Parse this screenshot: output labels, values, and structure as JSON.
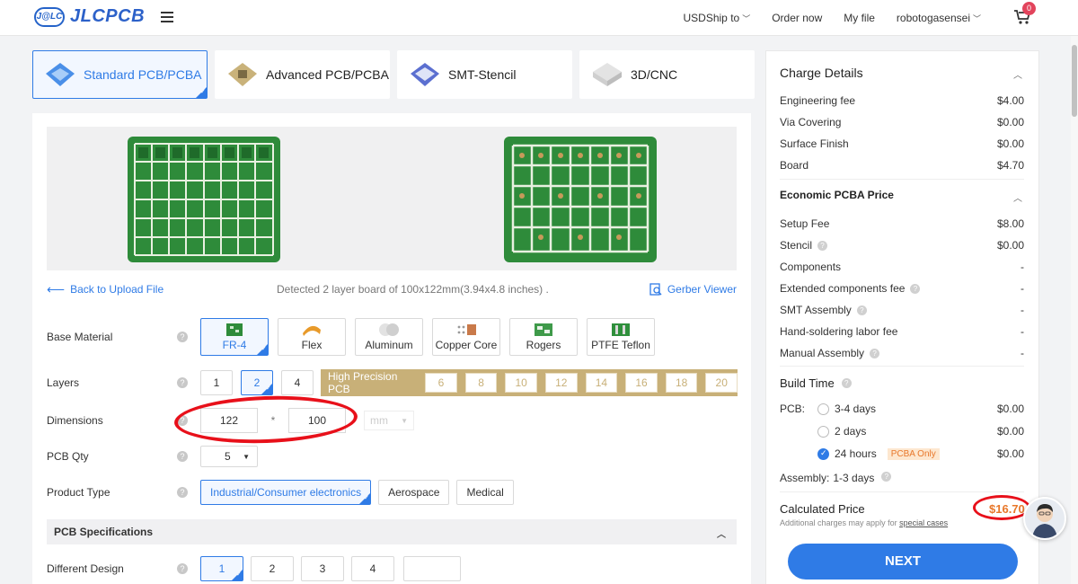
{
  "header": {
    "logo_badge": "J@LC",
    "logo_text": "JLCPCB",
    "nav": [
      {
        "label": "USDShip to",
        "caret": true
      },
      {
        "label": "Order now",
        "caret": false
      },
      {
        "label": "My file",
        "caret": false
      },
      {
        "label": "robotogasensei",
        "caret": true
      }
    ],
    "cart_count": "0"
  },
  "product_tabs": [
    {
      "label": "Standard PCB/PCBA",
      "active": true
    },
    {
      "label": "Advanced PCB/PCBA",
      "active": false
    },
    {
      "label": "SMT-Stencil",
      "active": false
    },
    {
      "label": "3D/CNC",
      "active": false
    }
  ],
  "file_row": {
    "back_label": "Back to Upload File",
    "detected": "Detected 2 layer board of 100x122mm(3.94x4.8 inches) .",
    "gerber_label": "Gerber Viewer"
  },
  "form": {
    "base_material": {
      "label": "Base Material",
      "options": [
        "FR-4",
        "Flex",
        "Aluminum",
        "Copper Core",
        "Rogers",
        "PTFE Teflon"
      ],
      "selected": "FR-4"
    },
    "layers": {
      "label": "Layers",
      "options": [
        "1",
        "2",
        "4"
      ],
      "selected": "2",
      "high_precision_label": "High Precision PCB",
      "high_precision_options": [
        "6",
        "8",
        "10",
        "12",
        "14",
        "16",
        "18",
        "20"
      ]
    },
    "dimensions": {
      "label": "Dimensions",
      "width": "122",
      "separator": "*",
      "height": "100",
      "unit": "mm"
    },
    "pcb_qty": {
      "label": "PCB Qty",
      "value": "5"
    },
    "product_type": {
      "label": "Product Type",
      "options": [
        "Industrial/Consumer electronics",
        "Aerospace",
        "Medical"
      ],
      "selected": "Industrial/Consumer electronics"
    },
    "pcb_specifications": "PCB Specifications",
    "different_design": {
      "label": "Different Design",
      "options": [
        "1",
        "2",
        "3",
        "4"
      ],
      "selected": "1"
    }
  },
  "charge_details": {
    "title": "Charge Details",
    "lines": [
      {
        "name": "Engineering fee",
        "value": "$4.00"
      },
      {
        "name": "Via Covering",
        "value": "$0.00"
      },
      {
        "name": "Surface Finish",
        "value": "$0.00"
      },
      {
        "name": "Board",
        "value": "$4.70"
      }
    ],
    "pcba_title": "Economic PCBA Price",
    "pcba_lines": [
      {
        "name": "Setup Fee",
        "value": "$8.00",
        "help": false
      },
      {
        "name": "Stencil",
        "value": "$0.00",
        "help": true
      },
      {
        "name": "Components",
        "value": "-",
        "help": false
      },
      {
        "name": "Extended components fee",
        "value": "-",
        "help": true
      },
      {
        "name": "SMT Assembly",
        "value": "-",
        "help": true
      },
      {
        "name": "Hand-soldering labor fee",
        "value": "-",
        "help": false
      },
      {
        "name": "Manual Assembly",
        "value": "-",
        "help": true
      }
    ],
    "build_time": {
      "title": "Build Time",
      "pcb_label": "PCB:",
      "options": [
        {
          "label": "3-4 days",
          "value": "$0.00",
          "selected": false,
          "badge": ""
        },
        {
          "label": "2 days",
          "value": "$0.00",
          "selected": false,
          "badge": ""
        },
        {
          "label": "24 hours",
          "value": "$0.00",
          "selected": true,
          "badge": "PCBA Only"
        }
      ],
      "assembly_label": "Assembly:",
      "assembly_value": "1-3 days"
    },
    "calculated_title": "Calculated Price",
    "calculated_note": "Additional charges may apply for",
    "calculated_note_link": "special cases",
    "calculated_price": "$16.70",
    "next_label": "NEXT"
  },
  "colors": {
    "accent": "#2f7be6",
    "price": "#e8772a",
    "annotation": "#e8101a",
    "high_precision": "#c8b078"
  }
}
